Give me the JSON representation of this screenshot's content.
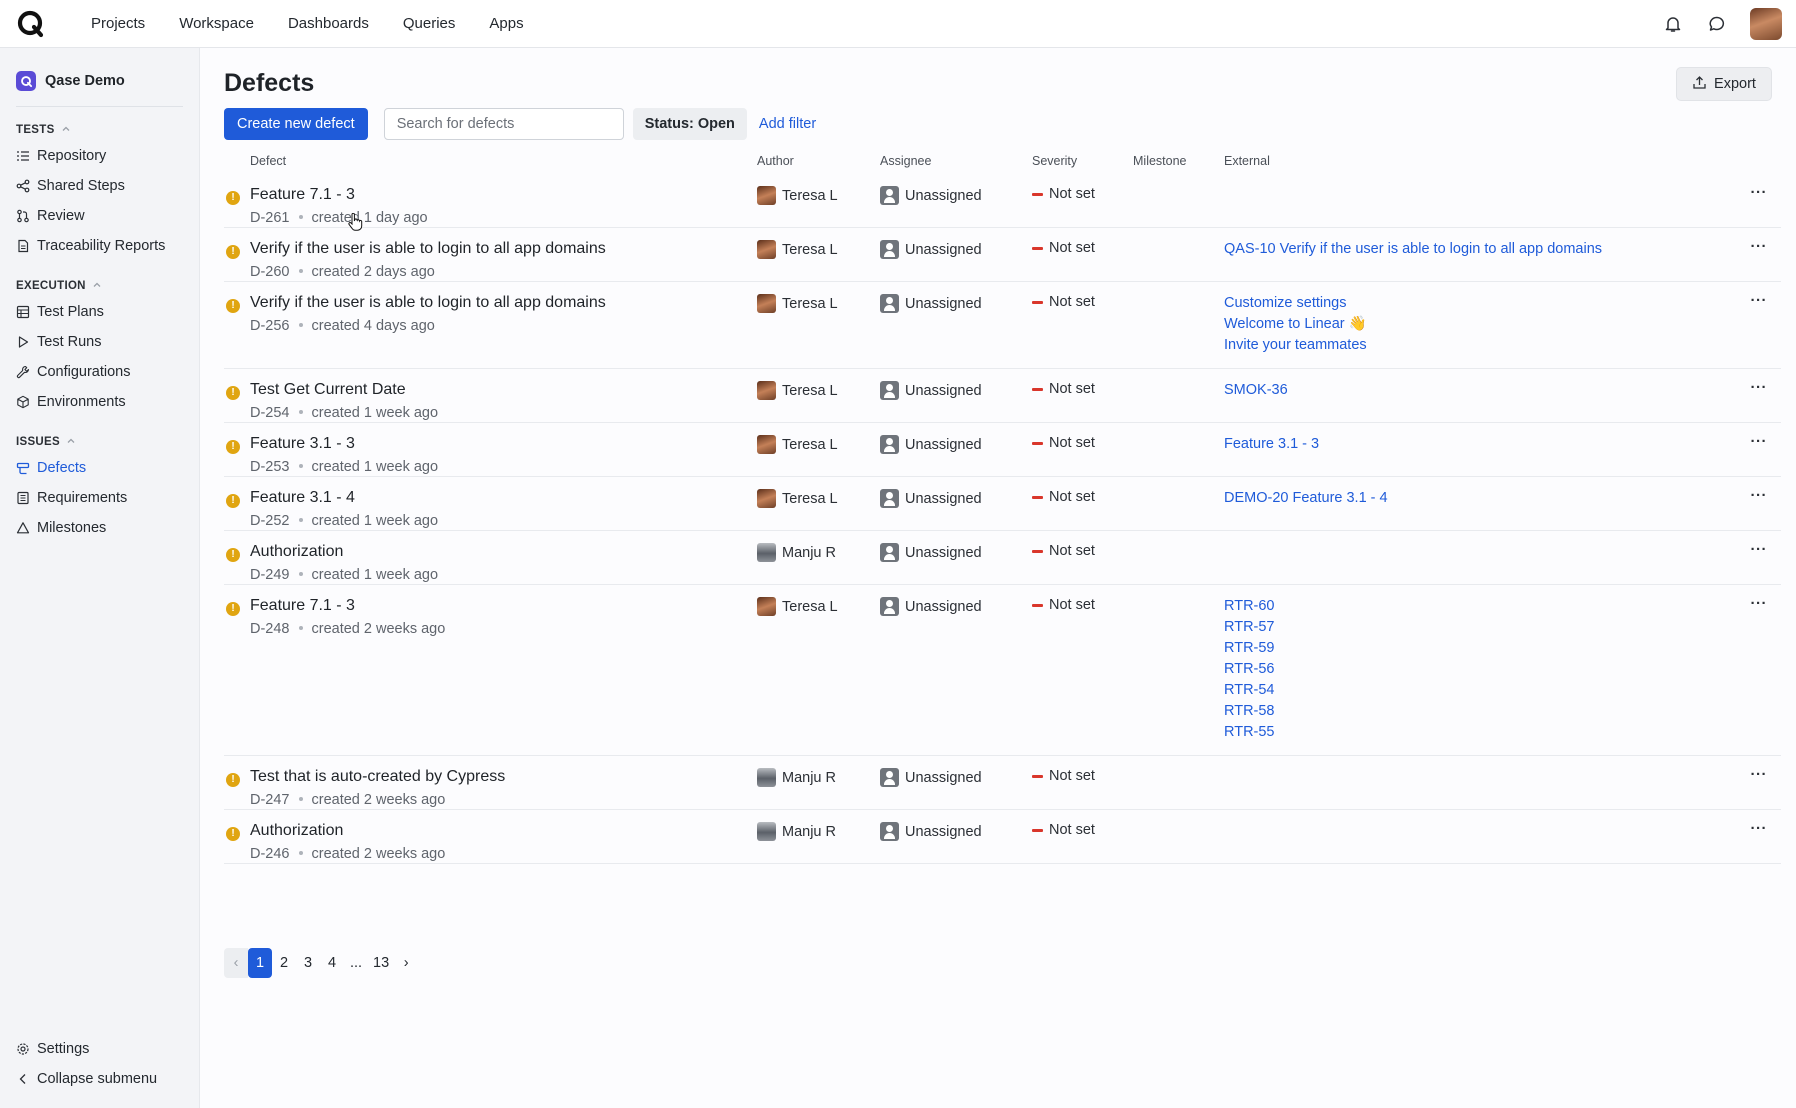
{
  "topbar": {
    "nav": [
      "Projects",
      "Workspace",
      "Dashboards",
      "Queries",
      "Apps"
    ]
  },
  "sidebar": {
    "project_name": "Qase Demo",
    "sections": [
      {
        "title": "TESTS",
        "items": [
          "Repository",
          "Shared Steps",
          "Review",
          "Traceability Reports"
        ]
      },
      {
        "title": "EXECUTION",
        "items": [
          "Test Plans",
          "Test Runs",
          "Configurations",
          "Environments"
        ]
      },
      {
        "title": "ISSUES",
        "items": [
          "Defects",
          "Requirements",
          "Milestones"
        ]
      }
    ],
    "active_item": "Defects",
    "settings_label": "Settings",
    "collapse_label": "Collapse submenu"
  },
  "main": {
    "title": "Defects",
    "export_label": "Export",
    "create_label": "Create new defect",
    "search_placeholder": "Search for defects",
    "status_filter": "Status: Open",
    "add_filter_label": "Add filter"
  },
  "table": {
    "columns": {
      "defect": "Defect",
      "author": "Author",
      "assignee": "Assignee",
      "severity": "Severity",
      "milestone": "Milestone",
      "external": "External"
    },
    "rows": [
      {
        "title": "Feature 7.1 - 3",
        "id": "D-261",
        "created": "created 1 day ago",
        "author": "Teresa L",
        "assignee": "Unassigned",
        "severity": "Not set",
        "external": []
      },
      {
        "title": "Verify if the user is able to login to all app domains",
        "id": "D-260",
        "created": "created 2 days ago",
        "author": "Teresa L",
        "assignee": "Unassigned",
        "severity": "Not set",
        "external": [
          "QAS-10 Verify if the user is able to login to all app domains"
        ]
      },
      {
        "title": "Verify if the user is able to login to all app domains",
        "id": "D-256",
        "created": "created 4 days ago",
        "author": "Teresa L",
        "assignee": "Unassigned",
        "severity": "Not set",
        "external": [
          "Customize settings",
          "Welcome to Linear 👋",
          "Invite your teammates"
        ]
      },
      {
        "title": "Test Get Current Date",
        "id": "D-254",
        "created": "created 1 week ago",
        "author": "Teresa L",
        "assignee": "Unassigned",
        "severity": "Not set",
        "external": [
          "SMOK-36"
        ]
      },
      {
        "title": "Feature 3.1 - 3",
        "id": "D-253",
        "created": "created 1 week ago",
        "author": "Teresa L",
        "assignee": "Unassigned",
        "severity": "Not set",
        "external": [
          "Feature 3.1 - 3"
        ]
      },
      {
        "title": "Feature 3.1 - 4",
        "id": "D-252",
        "created": "created 1 week ago",
        "author": "Teresa L",
        "assignee": "Unassigned",
        "severity": "Not set",
        "external": [
          "DEMO-20 Feature 3.1 - 4"
        ]
      },
      {
        "title": "Authorization",
        "id": "D-249",
        "created": "created 1 week ago",
        "author": "Manju R",
        "assignee": "Unassigned",
        "severity": "Not set",
        "external": []
      },
      {
        "title": "Feature 7.1 - 3",
        "id": "D-248",
        "created": "created 2 weeks ago",
        "author": "Teresa L",
        "assignee": "Unassigned",
        "severity": "Not set",
        "external": [
          "RTR-60",
          "RTR-57",
          "RTR-59",
          "RTR-56",
          "RTR-54",
          "RTR-58",
          "RTR-55"
        ]
      },
      {
        "title": "Test that is auto-created by Cypress",
        "id": "D-247",
        "created": "created 2 weeks ago",
        "author": "Manju R",
        "assignee": "Unassigned",
        "severity": "Not set",
        "external": []
      },
      {
        "title": "Authorization",
        "id": "D-246",
        "created": "created 2 weeks ago",
        "author": "Manju R",
        "assignee": "Unassigned",
        "severity": "Not set",
        "external": []
      }
    ],
    "more_label": "···"
  },
  "pagination": {
    "prev": "‹",
    "pages": [
      "1",
      "2",
      "3",
      "4",
      "...",
      "13"
    ],
    "current": "1",
    "next": "›"
  },
  "colors": {
    "accent": "#1f5bd9",
    "status_open": "#e0a511",
    "severity_dash": "#d9362b"
  },
  "icons": [
    "qase-logo",
    "bell-icon",
    "chat-icon",
    "export-icon",
    "status-open-icon",
    "more-icon"
  ]
}
